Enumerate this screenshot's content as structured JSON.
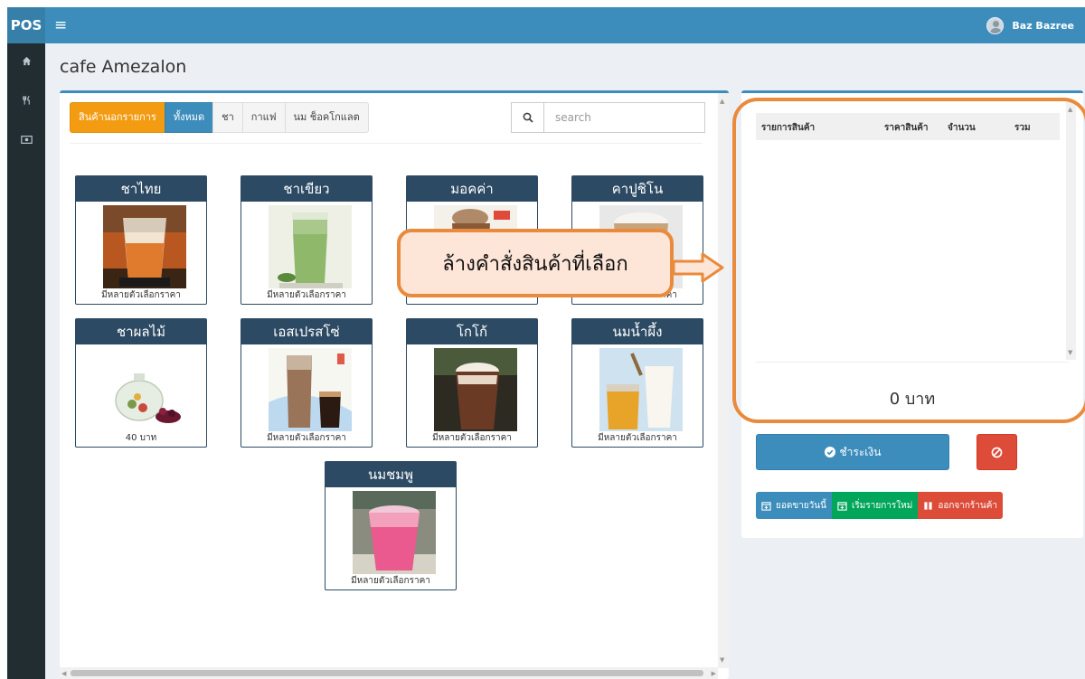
{
  "app": {
    "brand": "POS",
    "user_name": "Baz Bazree"
  },
  "page": {
    "title": "cafe Amezalon"
  },
  "categories": [
    {
      "label": "สินค้านอกรายการ",
      "style": "out"
    },
    {
      "label": "ทั้งหมด",
      "style": "active"
    },
    {
      "label": "ชา",
      "style": "default"
    },
    {
      "label": "กาแฟ",
      "style": "default"
    },
    {
      "label": "นม ช็อคโกแลต",
      "style": "default"
    }
  ],
  "search": {
    "placeholder": "search"
  },
  "products": [
    {
      "name": "ชาไทย",
      "price": "มีหลายตัวเลือกราคา",
      "image": "thai-tea"
    },
    {
      "name": "ชาเขียว",
      "price": "มีหลายตัวเลือกราคา",
      "image": "green-tea"
    },
    {
      "name": "มอคค่า",
      "price": "มีหลายตัวเลือกราคา",
      "image": "mocha"
    },
    {
      "name": "คาปูชิโน",
      "price": "มีหลายตัวเลือกราคา",
      "image": "cappuccino"
    },
    {
      "name": "ชาผลไม้",
      "price": "40 บาท",
      "image": "fruit-tea"
    },
    {
      "name": "เอสเปรสโซ่",
      "price": "มีหลายตัวเลือกราคา",
      "image": "espresso"
    },
    {
      "name": "โกโก้",
      "price": "มีหลายตัวเลือกราคา",
      "image": "cocoa"
    },
    {
      "name": "นมน้ำผึ้ง",
      "price": "มีหลายตัวเลือกราคา",
      "image": "honey-milk"
    },
    {
      "name": "นมชมพู",
      "price": "มีหลายตัวเลือกราคา",
      "image": "pink-milk"
    }
  ],
  "order": {
    "columns": [
      "รายการสินค้า",
      "ราคาสินค้า",
      "จำนวน",
      "รวม"
    ],
    "total": "0 บาท",
    "pay_label": "ชำระเงิน",
    "buttons": {
      "today_sales": "ยอดขายวันนี้",
      "new_order": "เริ่มรายการใหม่",
      "exit": "ออกจากร้านค้า"
    }
  },
  "annotation": {
    "text": "ล้างคำสั่งสินค้าที่เลือก",
    "color": "#e98a3c"
  },
  "colors": {
    "primary": "#3c8dbc",
    "sidebar": "#222d32",
    "warning": "#f39c12",
    "success": "#00a65a",
    "danger": "#dd4b39",
    "card_header": "#2c4a63"
  }
}
